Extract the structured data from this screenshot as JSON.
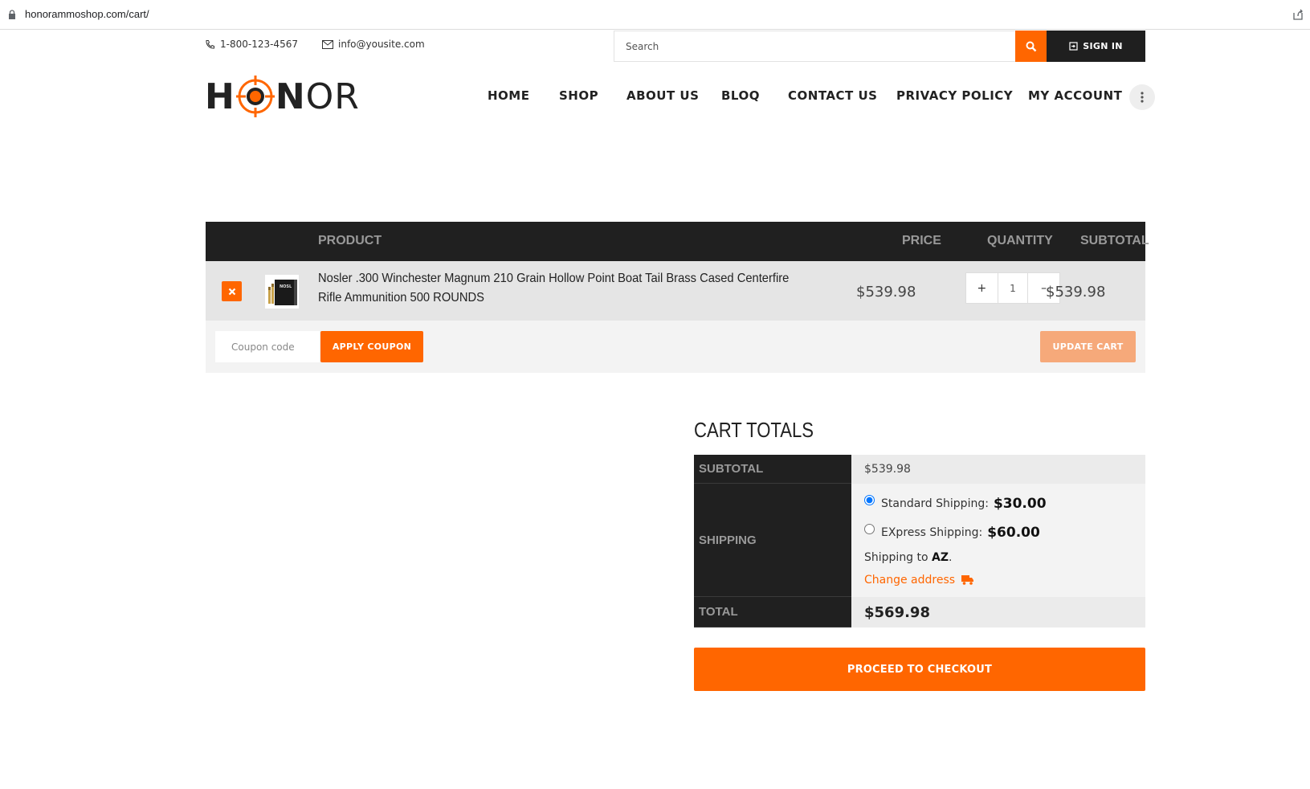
{
  "browser": {
    "url": "honorammoshop.com/cart/"
  },
  "topbar": {
    "phone": "1-800-123-4567",
    "email": "info@yousite.com",
    "search_placeholder": "Search",
    "signin_label": "SIGN IN"
  },
  "logo": {
    "part1": "H",
    "part2": "N",
    "part3": "OR",
    "brand_text": "HONOR"
  },
  "nav": {
    "items": [
      "HOME",
      "SHOP",
      "ABOUT US",
      "BLOQ",
      "CONTACT US",
      "PRIVACY POLICY",
      "MY ACCOUNT"
    ]
  },
  "cart": {
    "headers": {
      "product": "PRODUCT",
      "price": "PRICE",
      "quantity": "QUANTITY",
      "subtotal": "SUBTOTAL"
    },
    "items": [
      {
        "name": "Nosler .300 Winchester Magnum 210 Grain Hollow Point Boat Tail Brass Cased Centerfire Rifle Ammunition 500 ROUNDS",
        "price": "$539.98",
        "quantity": "1",
        "subtotal": "$539.98",
        "thumb_text": "NOSL"
      }
    ],
    "coupon_placeholder": "Coupon code",
    "apply_coupon_label": "APPLY COUPON",
    "update_cart_label": "UPDATE CART"
  },
  "totals": {
    "title": "CART TOTALS",
    "subtotal_label": "SUBTOTAL",
    "subtotal_value": "$539.98",
    "shipping_label": "SHIPPING",
    "shipping_options": [
      {
        "label": "Standard Shipping:",
        "price": "$30.00",
        "selected": true
      },
      {
        "label": "EXpress Shipping:",
        "price": "$60.00",
        "selected": false
      }
    ],
    "shipping_to_prefix": "Shipping to ",
    "shipping_to_state": "AZ",
    "shipping_to_suffix": ".",
    "change_address_label": "Change address",
    "total_label": "TOTAL",
    "total_value": "$569.98",
    "checkout_label": "PROCEED TO CHECKOUT"
  },
  "colors": {
    "accent": "#ff6600",
    "dark": "#202020"
  }
}
